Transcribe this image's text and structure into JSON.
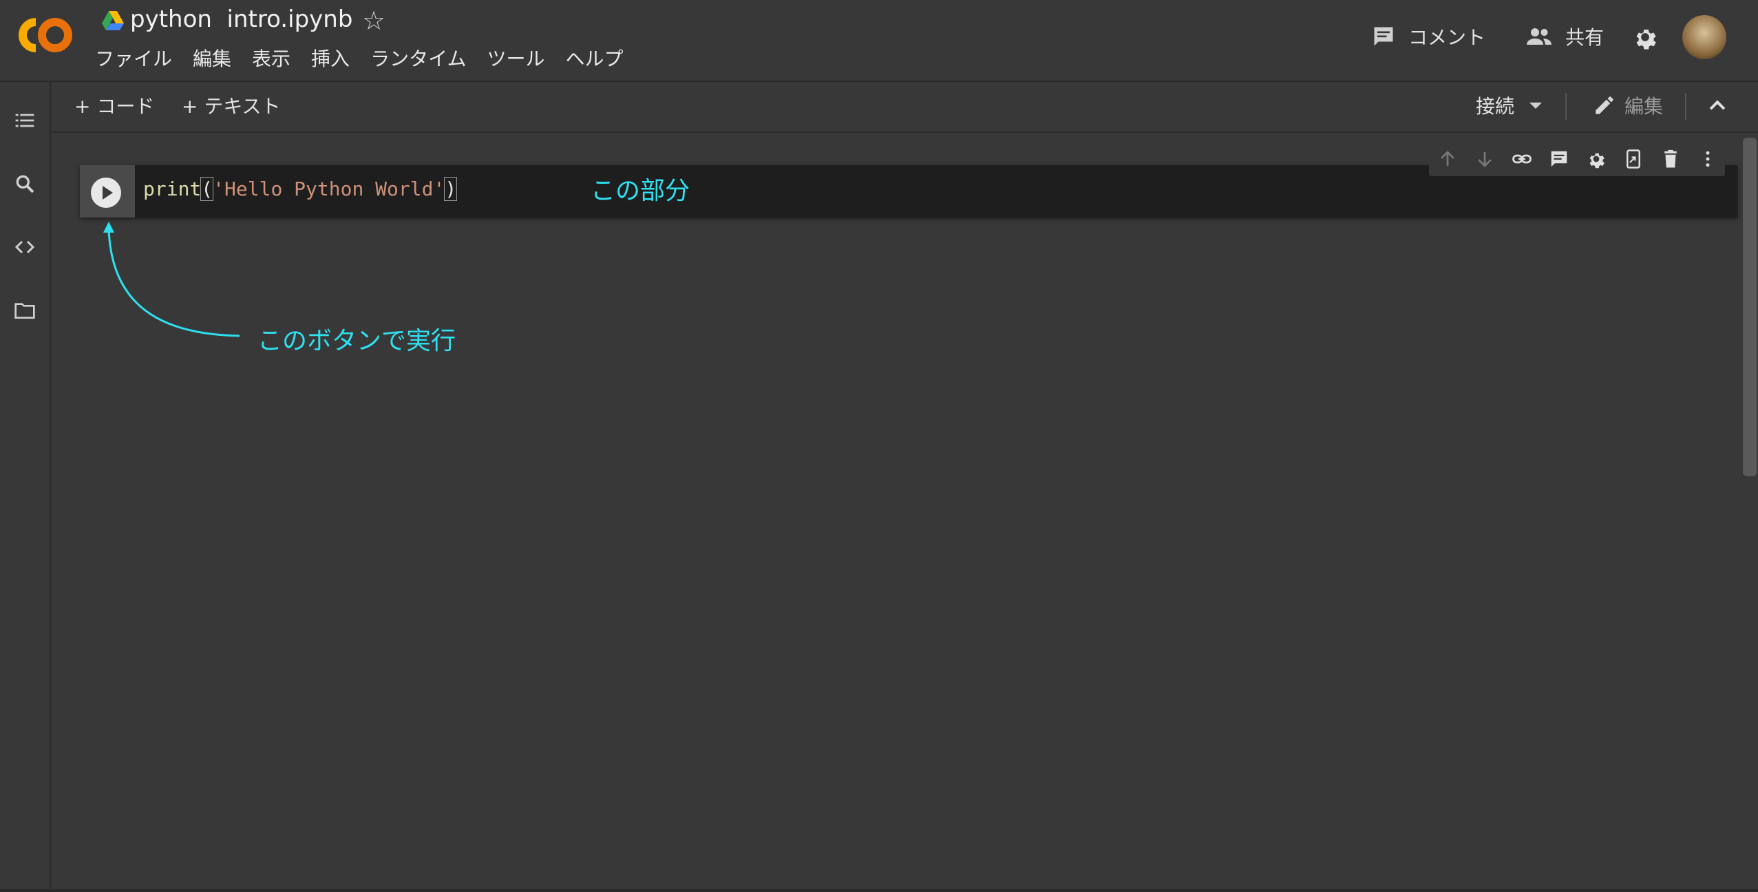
{
  "header": {
    "title": "python  intro.ipynb",
    "menu": [
      "ファイル",
      "編集",
      "表示",
      "挿入",
      "ランタイム",
      "ツール",
      "ヘルプ"
    ],
    "comment_label": "コメント",
    "share_label": "共有"
  },
  "sidebar": {
    "icons": [
      "toc-icon",
      "search-icon",
      "code-snippets-icon",
      "folder-icon"
    ]
  },
  "toolbar": {
    "add_code": "+ コード",
    "add_text": "+ テキスト",
    "connect": "接続",
    "edit": "編集"
  },
  "cell": {
    "code_fn": "print",
    "code_open": "(",
    "code_str": "'Hello Python World'",
    "code_close": ")",
    "toolbar_icons": [
      "arrow-up-icon",
      "arrow-down-icon",
      "link-icon",
      "comment-icon",
      "gear-icon",
      "mirror-cell-icon",
      "delete-icon",
      "more-icon"
    ]
  },
  "annotations": {
    "part_label": "この部分",
    "run_label": "このボタンで実行"
  },
  "colors": {
    "background": "#383838",
    "cell_background": "#1e1e1e",
    "annotation": "#2ee0f0",
    "string": "#ce9178",
    "function": "#dcdcaa"
  }
}
